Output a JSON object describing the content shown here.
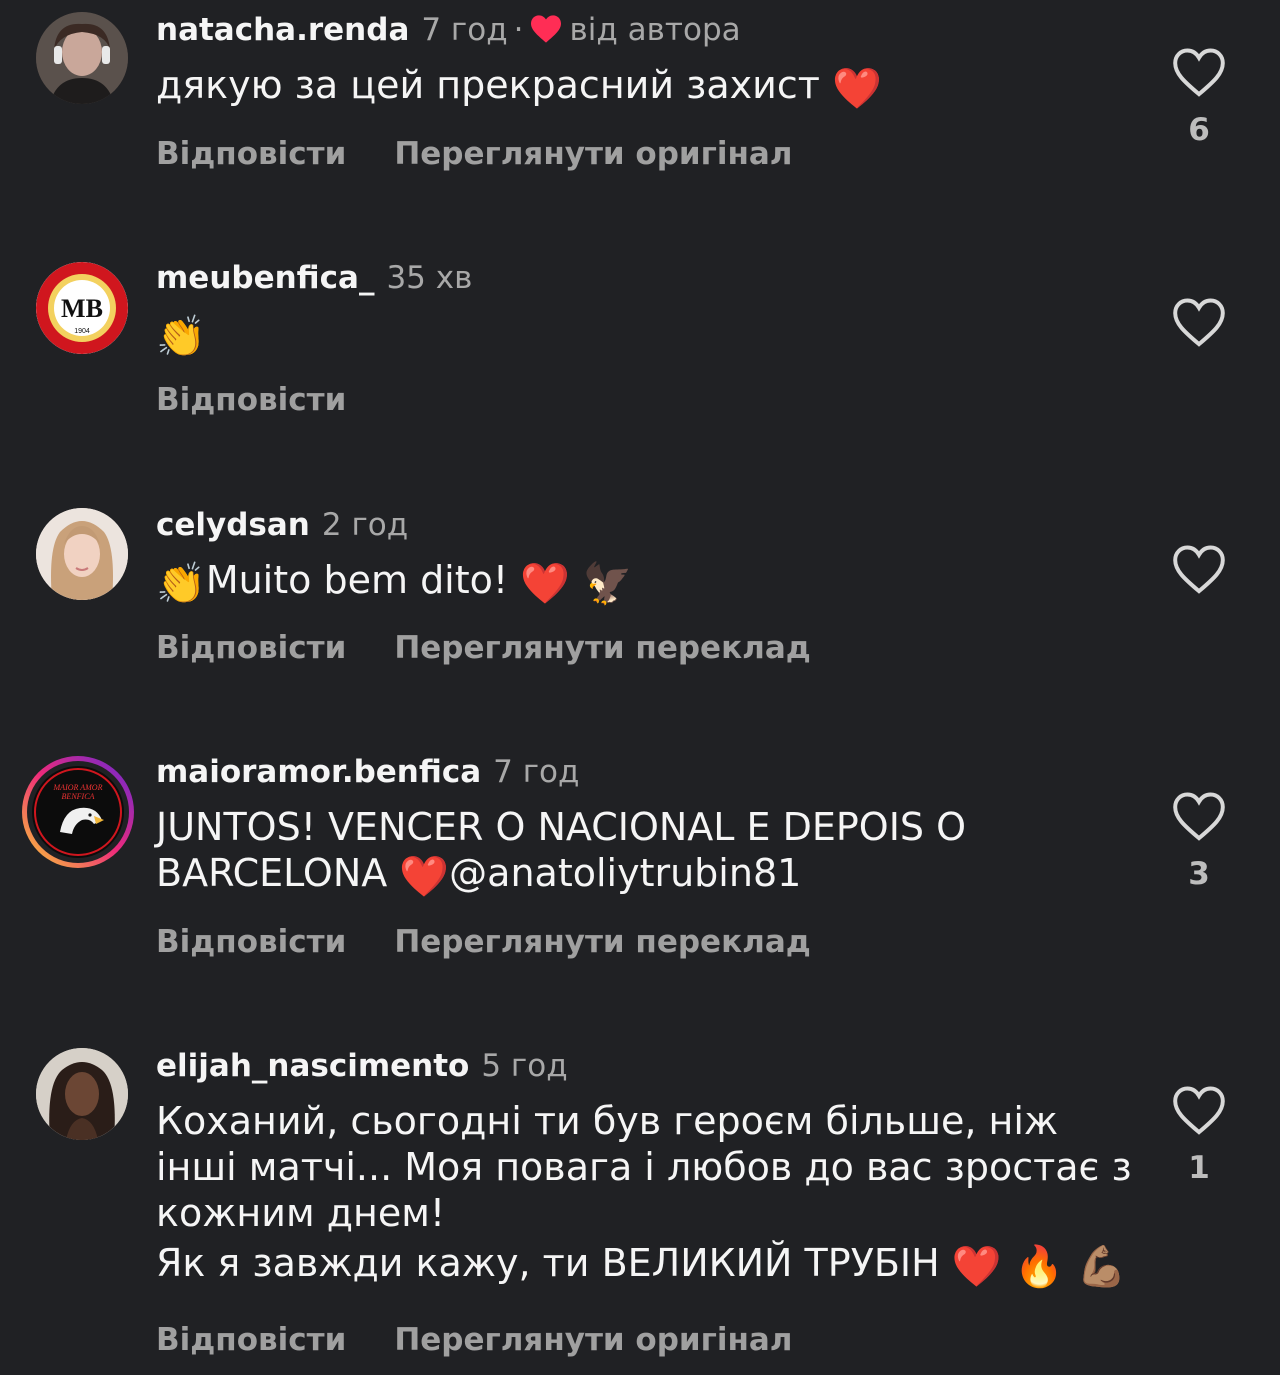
{
  "comments": [
    {
      "username": "natacha.renda",
      "time": "7 год",
      "separator": "·",
      "author_label": "від автора",
      "text": [
        "дякую за цей прекрасний захист"
      ],
      "emoji_after": "❤️",
      "reply_label": "Відповісти",
      "secondary_label": "Переглянути оригінал",
      "likes": "6"
    },
    {
      "username": "meubenfica_",
      "time": "35 хв",
      "text": [
        ""
      ],
      "emoji_after": "👏",
      "reply_label": "Відповісти",
      "likes": ""
    },
    {
      "username": "celydsan",
      "time": "2 год",
      "text": [
        "Muito bem dito!"
      ],
      "emoji_before": "👏",
      "emoji_after": "❤️ 🦅",
      "reply_label": "Відповісти",
      "secondary_label": "Переглянути переклад",
      "likes": ""
    },
    {
      "username": "maioramor.benfica",
      "time": "7 год",
      "text_line1": "JUNTOS! VENCER O NACIONAL E DEPOIS O",
      "text_line2_a": "BARCELONA",
      "text_line2_emoji": "❤️",
      "text_line2_b": "@anatoliytrubin81",
      "reply_label": "Відповісти",
      "secondary_label": "Переглянути переклад",
      "likes": "3"
    },
    {
      "username": "elijah_nascimento",
      "time": "5 год",
      "text_p1": "Коханий, сьогодні ти був героєм більше, ніж інші матчі... Моя повага і любов до вас зростає з кожним днем!",
      "text_p2": "Як я завжди кажу, ти ВЕЛИКИЙ ТРУБІН",
      "text_p2_emoji": "❤️ 🔥 💪🏽",
      "reply_label": "Відповісти",
      "secondary_label": "Переглянути оригінал",
      "likes": "1"
    }
  ],
  "avatar_texts": {
    "meubenfica_": "MB",
    "meubenfica_year": "1904",
    "maioramor_top": "MAIOR AMOR",
    "maioramor_mid": "BENFICA"
  },
  "colors": {
    "background": "#202124",
    "text": "#f5f5f5",
    "muted": "#a8a8a8",
    "author_heart": "#ff2d55",
    "story_ring_start": "#f9ce34",
    "story_ring_mid": "#ee2a7b",
    "story_ring_end": "#6228d7"
  }
}
